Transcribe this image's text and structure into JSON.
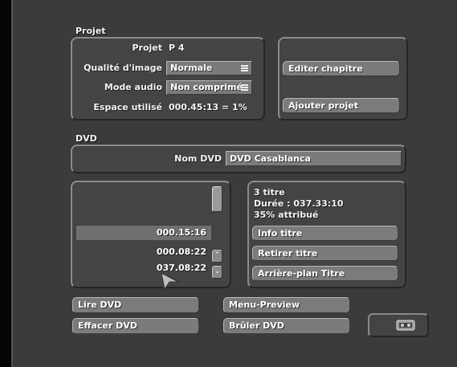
{
  "projet": {
    "section_title": "Projet",
    "projet_label": "Projet",
    "projet_value": "P 4",
    "qualite_label": "Qualité d'image",
    "qualite_value": "Normale",
    "mode_label": "Mode audio",
    "mode_value": "Non comprimé",
    "espace_label": "Espace utilisé",
    "espace_value": "000.45:13 = 1%",
    "editer_chapitre": "Editer chapitre",
    "ajouter_projet": "Ajouter projet"
  },
  "dvd": {
    "section_title": "DVD",
    "nom_label": "Nom DVD",
    "nom_value": "DVD Casablanca",
    "titles": [
      {
        "duration": "000.15:16"
      },
      {
        "duration": "000.08:22"
      },
      {
        "duration": "037.08:22"
      }
    ],
    "info_count": "3 titre",
    "info_duration": "Durée : 037.33:10",
    "info_percent": "35% attribué",
    "info_titre": "Info titre",
    "retirer_titre": "Retirer titre",
    "arriere_plan": "Arrière-plan Titre"
  },
  "actions": {
    "lire_dvd": "Lire DVD",
    "effacer_dvd": "Effacer DVD",
    "menu_preview": "Menu-Preview",
    "bruler_dvd": "Brûler DVD"
  },
  "icons": {
    "scroll_up": "scroll-up-icon",
    "scroll_down": "scroll-down-icon",
    "tape": "tape-icon",
    "cursor": "pointer-cursor-icon"
  }
}
